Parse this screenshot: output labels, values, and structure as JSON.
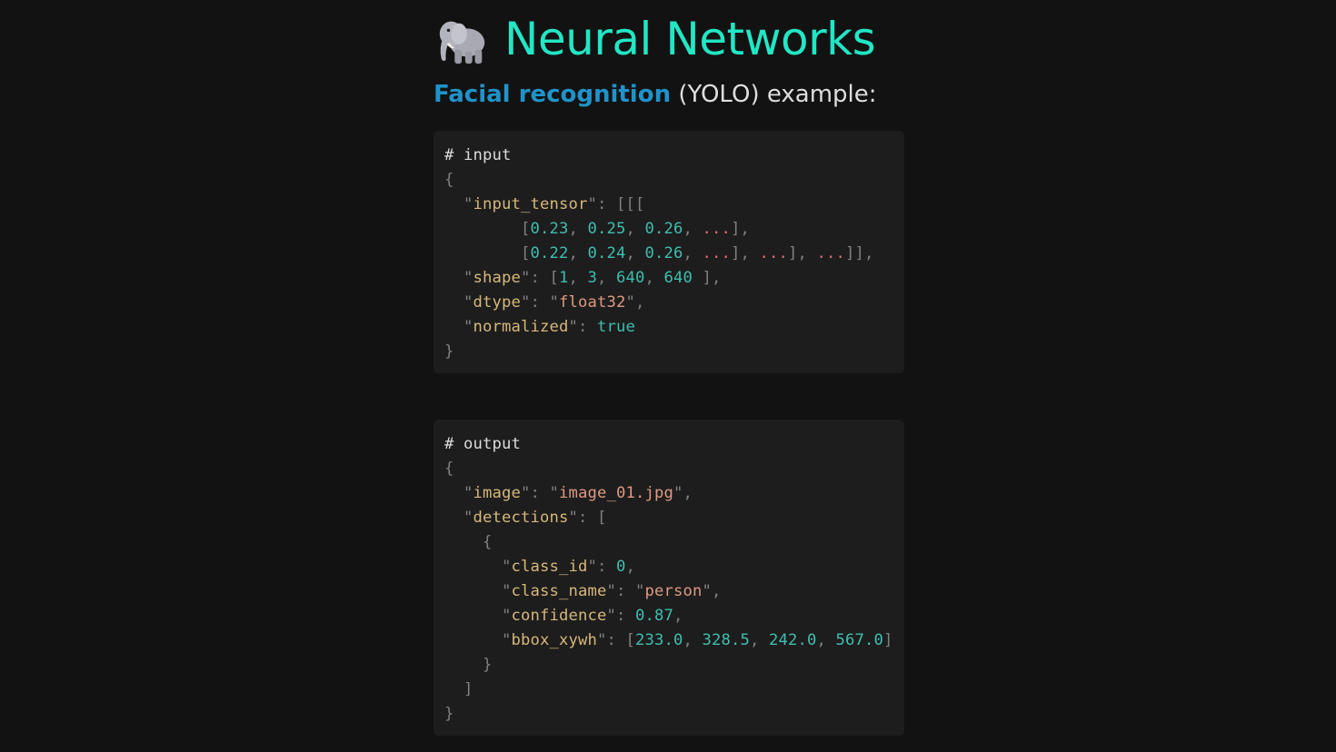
{
  "header": {
    "emoji_icon": "elephant-icon",
    "title": "Neural Networks"
  },
  "subtitle": {
    "link_text": "Facial recognition",
    "rest_text": " (YOLO) example:"
  },
  "input_block": {
    "comment": "# input",
    "open": "{",
    "close": "}",
    "input_tensor_key": "input_tensor",
    "row1": [
      "0.23",
      "0.25",
      "0.26"
    ],
    "row2": [
      "0.22",
      "0.24",
      "0.26"
    ],
    "ellipsis": "...",
    "shape_key": "shape",
    "shape": [
      "1",
      "3",
      "640",
      "640"
    ],
    "dtype_key": "dtype",
    "dtype": "float32",
    "normalized_key": "normalized",
    "normalized": "true"
  },
  "output_block": {
    "comment": "# output",
    "open": "{",
    "close": "}",
    "image_key": "image",
    "image": "image_01.jpg",
    "detections_key": "detections",
    "class_id_key": "class_id",
    "class_id": "0",
    "class_name_key": "class_name",
    "class_name": "person",
    "confidence_key": "confidence",
    "confidence": "0.87",
    "bbox_key": "bbox_xywh",
    "bbox": [
      "233.0",
      "328.5",
      "242.0",
      "567.0"
    ]
  },
  "colors": {
    "title": "#22e6c4",
    "link": "#1f93c9",
    "background": "#121212",
    "code_background": "#1d1d1d",
    "json_key": "#d6b87a",
    "json_string": "#de9a82",
    "json_number": "#3fbfae",
    "ellipsis": "#e06c75"
  }
}
